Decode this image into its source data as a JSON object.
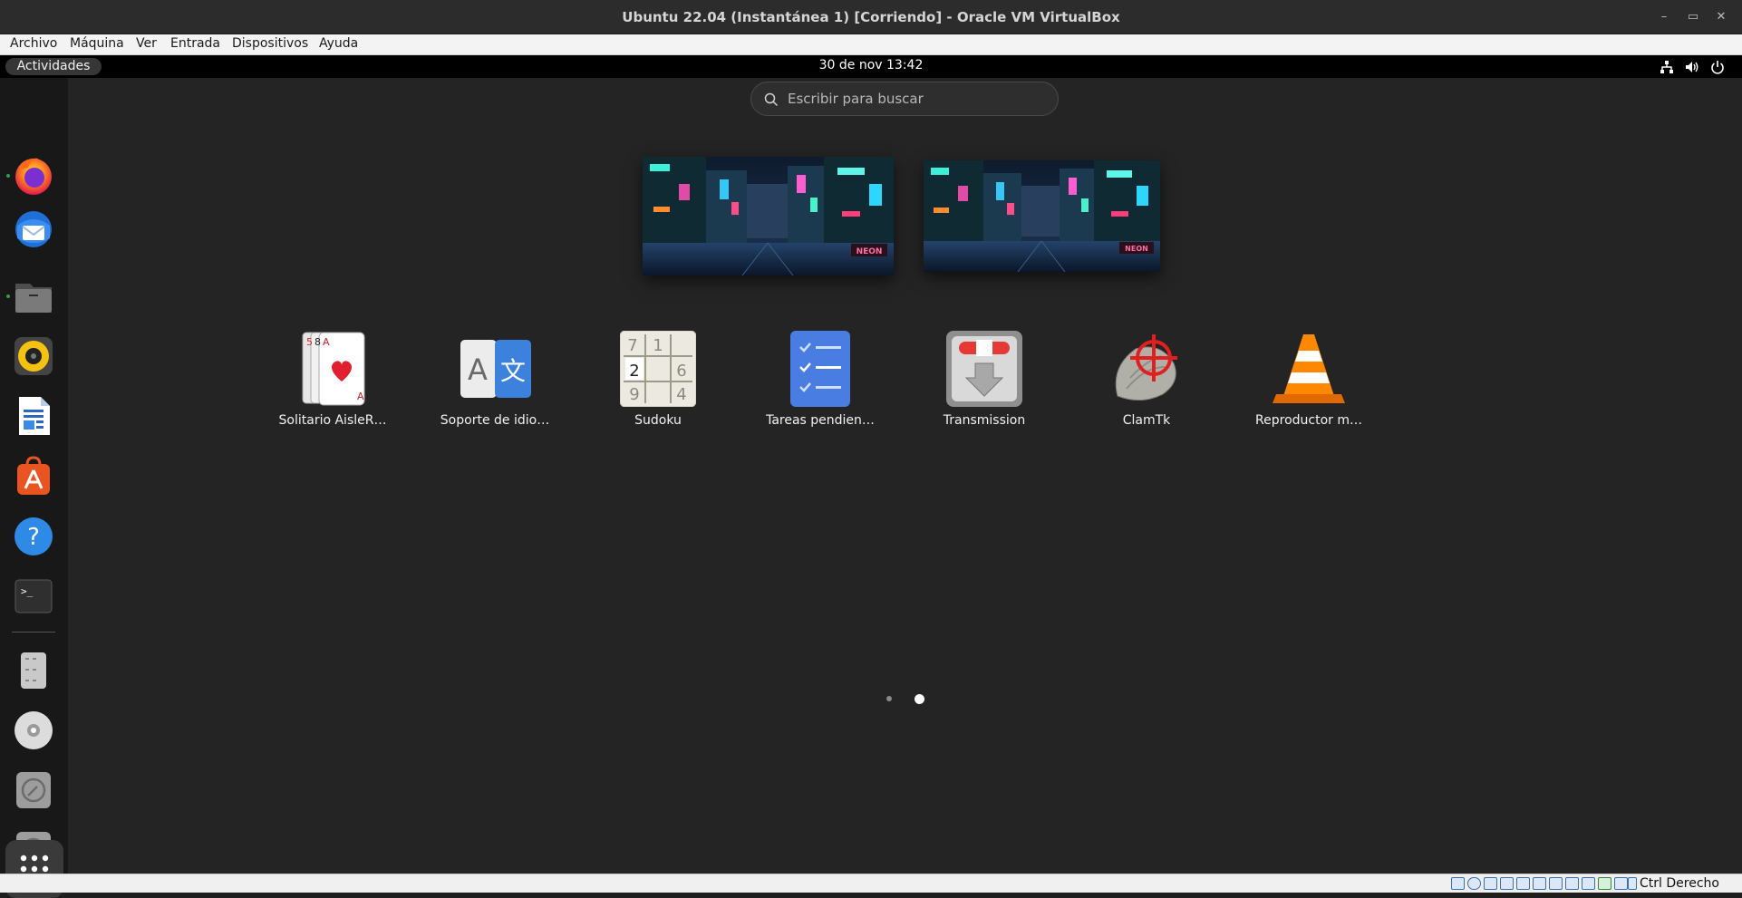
{
  "window": {
    "title": "Ubuntu 22.04 (Instantánea 1) [Corriendo] - Oracle VM VirtualBox",
    "controls": [
      "minimize-icon",
      "maximize-icon",
      "close-icon"
    ]
  },
  "menubar": {
    "items": [
      "Archivo",
      "Máquina",
      "Ver",
      "Entrada",
      "Dispositivos",
      "Ayuda"
    ]
  },
  "topbar": {
    "activities": "Actividades",
    "clock": "30 de nov  13:42",
    "tray": [
      "network-icon",
      "volume-icon",
      "power-icon"
    ]
  },
  "dock": {
    "items": [
      {
        "name": "firefox-icon",
        "running": true
      },
      {
        "name": "thunderbird-icon",
        "running": false
      },
      {
        "name": "files-icon",
        "running": true
      },
      {
        "name": "rhythmbox-icon",
        "running": false
      },
      {
        "name": "libreoffice-writer-icon",
        "running": false
      },
      {
        "name": "app-center-icon",
        "running": false
      },
      {
        "name": "help-icon",
        "running": false
      },
      {
        "name": "terminal-icon",
        "running": false
      },
      {
        "name": "usb-drive-icon",
        "running": false
      },
      {
        "name": "cd-drive-icon",
        "running": false
      },
      {
        "name": "optical-disc-icon",
        "running": false
      },
      {
        "name": "optical-disc-icon-2",
        "running": false
      }
    ],
    "show_apps": "show-apps-icon"
  },
  "overview": {
    "search_placeholder": "Escribir para buscar",
    "workspaces": [
      "workspace-1",
      "workspace-2"
    ],
    "wallpaper_text": "NEON"
  },
  "apps": [
    {
      "label": "Solitario AisleR…",
      "icon": "aisleriot-icon"
    },
    {
      "label": "Soporte de idio…",
      "icon": "language-support-icon"
    },
    {
      "label": "Sudoku",
      "icon": "sudoku-icon"
    },
    {
      "label": "Tareas pendien…",
      "icon": "todo-icon"
    },
    {
      "label": "Transmission",
      "icon": "transmission-icon"
    },
    {
      "label": "ClamTk",
      "icon": "clamtk-icon"
    },
    {
      "label": "Reproductor m…",
      "icon": "vlc-icon"
    }
  ],
  "card_text": {
    "c1": "5",
    "c2": "8",
    "c3": "A",
    "c4": "A"
  },
  "sudoku_digits": [
    "7",
    "1",
    "2",
    "6",
    "9",
    "4"
  ],
  "lang_letters": [
    "A",
    "文"
  ],
  "pages": {
    "count": 2,
    "current": 2
  },
  "statusbar": {
    "host_key": "Ctrl Derecho",
    "icons": [
      "hdd-icon",
      "optical-icon",
      "audio-icon",
      "network-status-icon",
      "usb-status-icon",
      "shared-folder-icon",
      "display-icon",
      "recording-icon",
      "cpu-icon",
      "mouse-integration-icon",
      "keyboard-icon",
      "arrow-down-icon"
    ]
  },
  "colors": {
    "accent": "#e95420",
    "background": "#242424",
    "running_dot": "#2aa04a"
  }
}
